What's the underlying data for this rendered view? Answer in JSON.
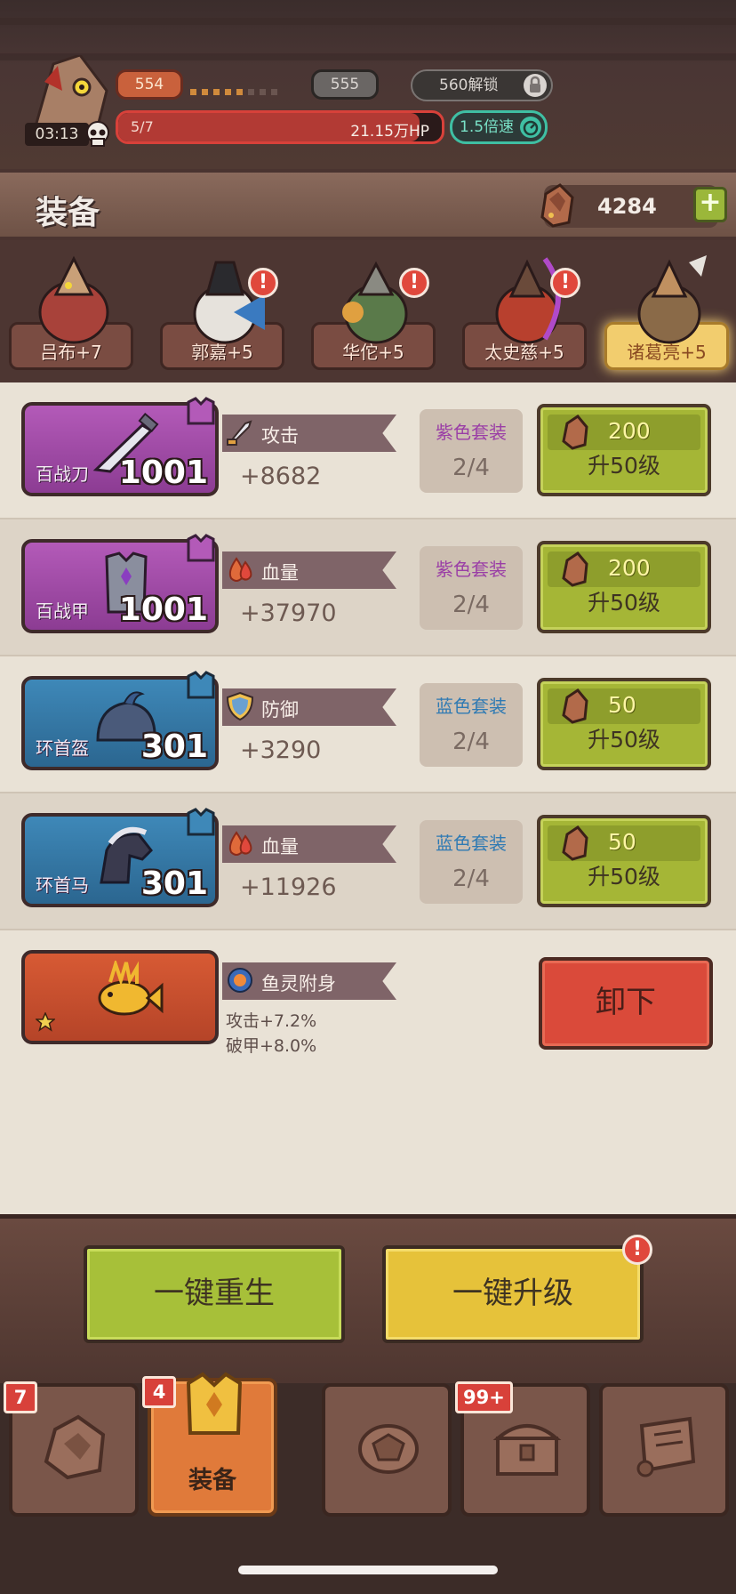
{
  "hud": {
    "timer": "03:13",
    "wave_current": "554",
    "wave_next": "555",
    "unlock_text": "560解锁",
    "hp_wave": "5/7",
    "hp_value": "21.15万HP",
    "hp_fraction": 0.93,
    "speed": "1.5倍速"
  },
  "header": {
    "title": "装备",
    "ore_amount": "4284"
  },
  "heroes": [
    {
      "name": "吕布+7",
      "alert": false,
      "selected": false
    },
    {
      "name": "郭嘉+5",
      "alert": true,
      "selected": false
    },
    {
      "name": "华佗+5",
      "alert": true,
      "selected": false
    },
    {
      "name": "太史慈+5",
      "alert": true,
      "selected": false
    },
    {
      "name": "诸葛亮+5",
      "alert": false,
      "selected": true
    }
  ],
  "equipment": [
    {
      "name": "百战刀",
      "level": "1001",
      "rarity": "purple",
      "stat_icon": "sword-icon",
      "stat_label": "攻击",
      "stat_value": "+8682",
      "set_label": "紫色套装",
      "set_count": "2/4",
      "cost": "200",
      "action": "升50级"
    },
    {
      "name": "百战甲",
      "level": "1001",
      "rarity": "purple",
      "stat_icon": "blood-drop-icon",
      "stat_label": "血量",
      "stat_value": "+37970",
      "set_label": "紫色套装",
      "set_count": "2/4",
      "cost": "200",
      "action": "升50级"
    },
    {
      "name": "环首盔",
      "level": "301",
      "rarity": "blue",
      "stat_icon": "shield-icon",
      "stat_label": "防御",
      "stat_value": "+3290",
      "set_label": "蓝色套装",
      "set_count": "2/4",
      "cost": "50",
      "action": "升50级"
    },
    {
      "name": "环首马",
      "level": "301",
      "rarity": "blue",
      "stat_icon": "blood-drop-icon",
      "stat_label": "血量",
      "stat_value": "+11926",
      "set_label": "蓝色套装",
      "set_count": "2/4",
      "cost": "50",
      "action": "升50级"
    }
  ],
  "spirit": {
    "skill_label": "鱼灵附身",
    "line1": "攻击+7.2%",
    "line2": "破甲+8.0%",
    "unequip": "卸下"
  },
  "actions": {
    "rebirth": "一键重生",
    "upgrade_all": "一键升级"
  },
  "tabs": [
    {
      "icon": "ore-tab-icon",
      "label": "",
      "badge": "7"
    },
    {
      "icon": "armor-tab-icon",
      "label": "装备",
      "badge": "4"
    },
    {
      "icon": "turtle-shell-icon",
      "label": "",
      "badge": ""
    },
    {
      "icon": "chest-icon",
      "label": "",
      "badge": "99+"
    },
    {
      "icon": "scroll-icon",
      "label": "",
      "badge": ""
    }
  ],
  "colors": {
    "purple_set": "#9a3ea6",
    "blue_set": "#2f7ab3",
    "upgrade_green": "#a5b636",
    "unequip_red": "#da4a3a",
    "tab_active": "#e07a3a"
  }
}
